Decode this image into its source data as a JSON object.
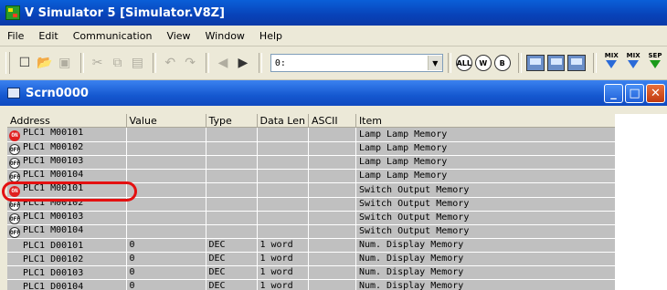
{
  "window": {
    "title": "V Simulator 5 [Simulator.V8Z]"
  },
  "menu": [
    {
      "label": "File"
    },
    {
      "label": "Edit"
    },
    {
      "label": "Communication"
    },
    {
      "label": "View"
    },
    {
      "label": "Window"
    },
    {
      "label": "Help"
    }
  ],
  "toolbar": {
    "address_value": "0:",
    "btn_all": "ALL",
    "btn_w": "W",
    "btn_b": "B",
    "mix1": "MIX",
    "mix2": "MIX",
    "sep_label": "SEP"
  },
  "child": {
    "title": "Scrn0000"
  },
  "table": {
    "headers": [
      "Address",
      "Value",
      "Type",
      "Data Len",
      "ASCII",
      "Item"
    ],
    "rows": [
      {
        "status": "ON",
        "address": "PLC1  M00101",
        "value": "",
        "type": "",
        "len": "",
        "ascii": "",
        "item": "Lamp Lamp Memory"
      },
      {
        "status": "OFF",
        "address": "PLC1  M00102",
        "value": "",
        "type": "",
        "len": "",
        "ascii": "",
        "item": "Lamp Lamp Memory"
      },
      {
        "status": "OFF",
        "address": "PLC1  M00103",
        "value": "",
        "type": "",
        "len": "",
        "ascii": "",
        "item": "Lamp Lamp Memory"
      },
      {
        "status": "OFF",
        "address": "PLC1  M00104",
        "value": "",
        "type": "",
        "len": "",
        "ascii": "",
        "item": "Lamp Lamp Memory"
      },
      {
        "status": "ON",
        "address": "PLC1  M00101",
        "value": "",
        "type": "",
        "len": "",
        "ascii": "",
        "item": "Switch Output Memory"
      },
      {
        "status": "OFF",
        "address": "PLC1  M00102",
        "value": "",
        "type": "",
        "len": "",
        "ascii": "",
        "item": "Switch Output Memory"
      },
      {
        "status": "OFF",
        "address": "PLC1  M00103",
        "value": "",
        "type": "",
        "len": "",
        "ascii": "",
        "item": "Switch Output Memory"
      },
      {
        "status": "OFF",
        "address": "PLC1  M00104",
        "value": "",
        "type": "",
        "len": "",
        "ascii": "",
        "item": "Switch Output Memory"
      },
      {
        "status": "",
        "address": "PLC1  D00101",
        "value": "0",
        "type": "DEC",
        "len": "1 word",
        "ascii": "",
        "item": "Num. Display Memory"
      },
      {
        "status": "",
        "address": "PLC1  D00102",
        "value": "0",
        "type": "DEC",
        "len": "1 word",
        "ascii": "",
        "item": "Num. Display Memory"
      },
      {
        "status": "",
        "address": "PLC1  D00103",
        "value": "0",
        "type": "DEC",
        "len": "1 word",
        "ascii": "",
        "item": "Num. Display Memory"
      },
      {
        "status": "",
        "address": "PLC1  D00104",
        "value": "0",
        "type": "DEC",
        "len": "1 word",
        "ascii": "",
        "item": "Num. Display Memory"
      }
    ]
  },
  "colors": {
    "highlight": "#e41010",
    "status_on": "#e02020",
    "row_bg": "#c0c0c0"
  }
}
